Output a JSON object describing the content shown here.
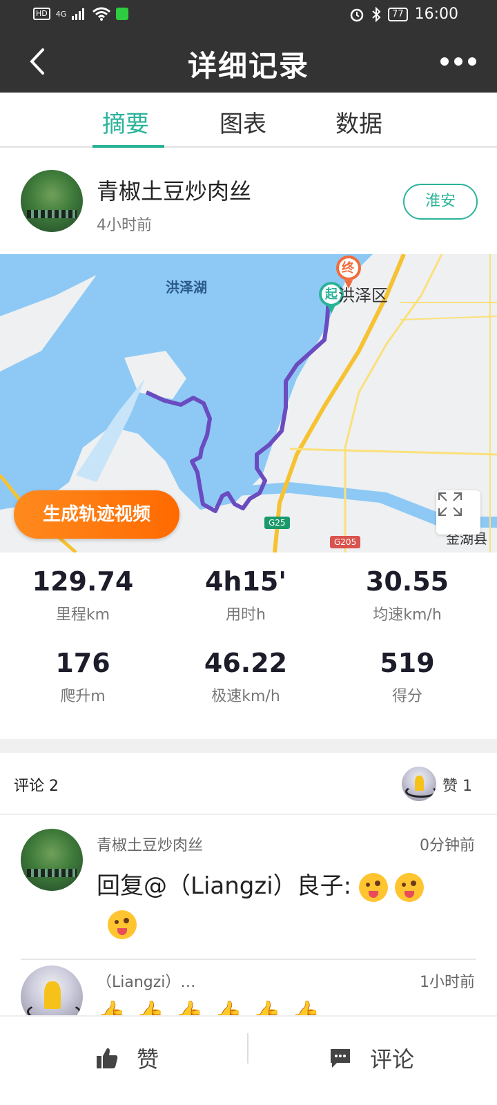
{
  "status_bar": {
    "network": "HD",
    "network_gen": "4G",
    "battery": "77",
    "time": "16:00",
    "icons": [
      "signal-icon",
      "wifi-icon",
      "vpn-icon",
      "alarm-icon",
      "bluetooth-icon",
      "battery-icon"
    ]
  },
  "header": {
    "title": "详细记录",
    "back_icon": "back-arrow-icon",
    "more_icon": "more-dots-icon"
  },
  "tabs": [
    {
      "label": "摘要",
      "active": true
    },
    {
      "label": "图表",
      "active": false
    },
    {
      "label": "数据",
      "active": false
    }
  ],
  "profile": {
    "name": "青椒土豆炒肉丝",
    "time": "4小时前",
    "city": "淮安"
  },
  "map": {
    "lake_label": "洪泽湖",
    "district_label": "洪泽区",
    "start_marker": "起",
    "end_marker": "终",
    "road_badges": [
      "G25",
      "G205"
    ],
    "generate_video_button": "生成轨迹视频",
    "edge_label": "金湖县",
    "colors": {
      "water": "#8ec9f5",
      "route": "#6a4cc0",
      "road": "#f7c232",
      "start": "#2bb39a",
      "end": "#f26b3a"
    }
  },
  "stats": [
    {
      "value": "129.74",
      "label": "里程km"
    },
    {
      "value": "4h15'",
      "label": "用时h"
    },
    {
      "value": "30.55",
      "label": "均速km/h"
    },
    {
      "value": "176",
      "label": "爬升m"
    },
    {
      "value": "46.22",
      "label": "极速km/h"
    },
    {
      "value": "519",
      "label": "得分"
    }
  ],
  "comments_header": {
    "label": "评论  2",
    "likes": "赞  1"
  },
  "comments": [
    {
      "author": "青椒土豆炒肉丝",
      "time": "0分钟前",
      "text": "回复@（Liangzi）良子: ",
      "emoji_count": 3
    },
    {
      "author": "（Liangzi）…",
      "time": "1小时前",
      "text": "",
      "thumb_count": 6
    }
  ],
  "bottom_bar": {
    "like_label": "赞",
    "comment_label": "评论"
  },
  "accent_color": "#2bb39a"
}
